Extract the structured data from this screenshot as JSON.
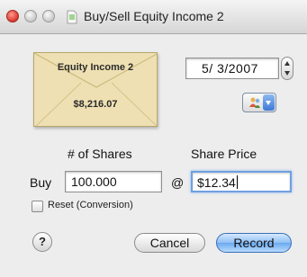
{
  "window": {
    "title": "Buy/Sell Equity Income 2",
    "icon": "document-green-icon"
  },
  "envelope": {
    "name": "Equity Income 2",
    "amount": "$8,216.07",
    "color": "#eee0b2"
  },
  "date": {
    "value": "5/ 3/2007"
  },
  "action_menu": {
    "icon": "people-icon"
  },
  "form": {
    "shares_label": "# of Shares",
    "price_label": "Share Price",
    "action_label": "Buy",
    "shares_value": "100.000",
    "at_sign": "@",
    "price_value": "$12.34",
    "reset_label": "Reset (Conversion)",
    "reset_checked": false
  },
  "buttons": {
    "help_label": "?",
    "cancel_label": "Cancel",
    "record_label": "Record"
  },
  "colors": {
    "focus_ring": "#6fa0df",
    "default_button": "#8ec0f5"
  }
}
